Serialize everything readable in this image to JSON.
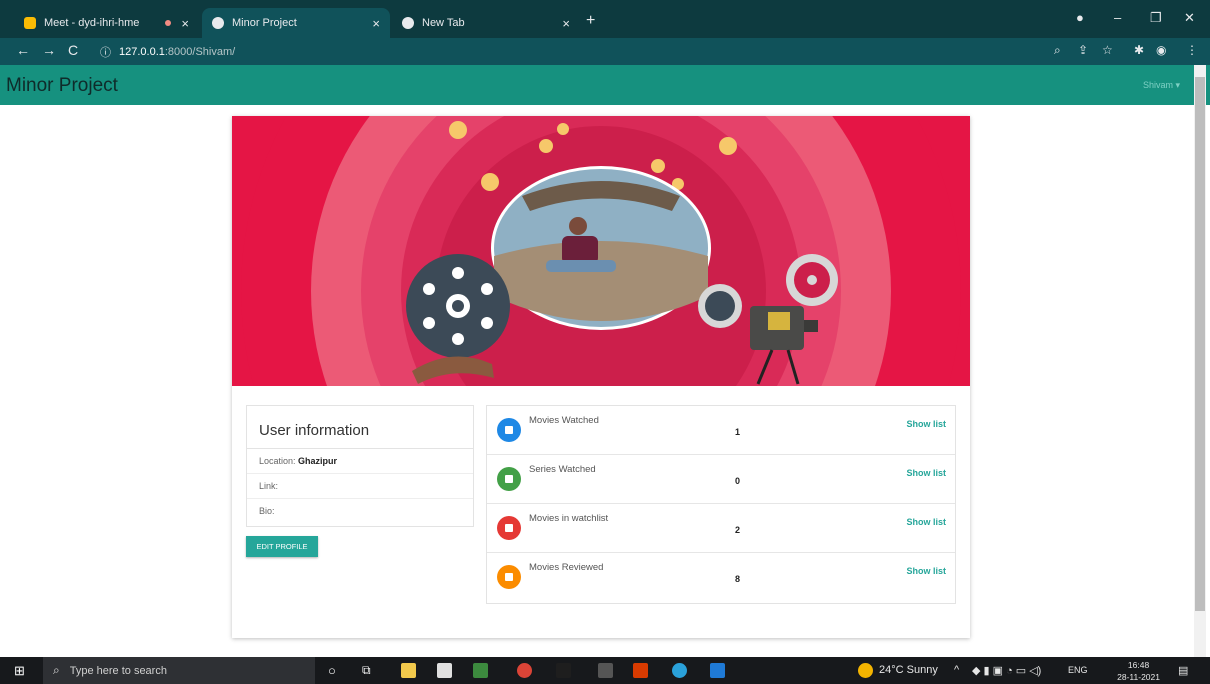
{
  "browser": {
    "tabs": [
      {
        "title": "Meet - dyd-ihri-hme",
        "active": false
      },
      {
        "title": "Minor Project",
        "active": true
      },
      {
        "title": "New Tab",
        "active": false
      }
    ],
    "url_host": "127.0.0.1",
    "url_path": ":8000/Shivam/"
  },
  "app": {
    "brand": "Minor Project",
    "user": "Shivam"
  },
  "user_information": {
    "title": "User information",
    "location_label": "Location:",
    "location_value": "Ghazipur",
    "link_label": "Link:",
    "bio_label": "Bio:",
    "edit_button": "EDIT PROFILE"
  },
  "stats": [
    {
      "label": "Movies Watched",
      "count": "1",
      "link": "Show list",
      "color": "#1e88e5"
    },
    {
      "label": "Series Watched",
      "count": "0",
      "link": "Show list",
      "color": "#43a047"
    },
    {
      "label": "Movies in watchlist",
      "count": "2",
      "link": "Show list",
      "color": "#e53935"
    },
    {
      "label": "Movies Reviewed",
      "count": "8",
      "link": "Show list",
      "color": "#fb8c00"
    }
  ],
  "taskbar": {
    "search_placeholder": "Type here to search",
    "weather": "24°C Sunny",
    "language": "ENG",
    "time": "16:48",
    "date": "28-11-2021"
  },
  "colors": {
    "app_bar": "#16917f",
    "accent": "#26a69a",
    "banner": "#e51545"
  }
}
